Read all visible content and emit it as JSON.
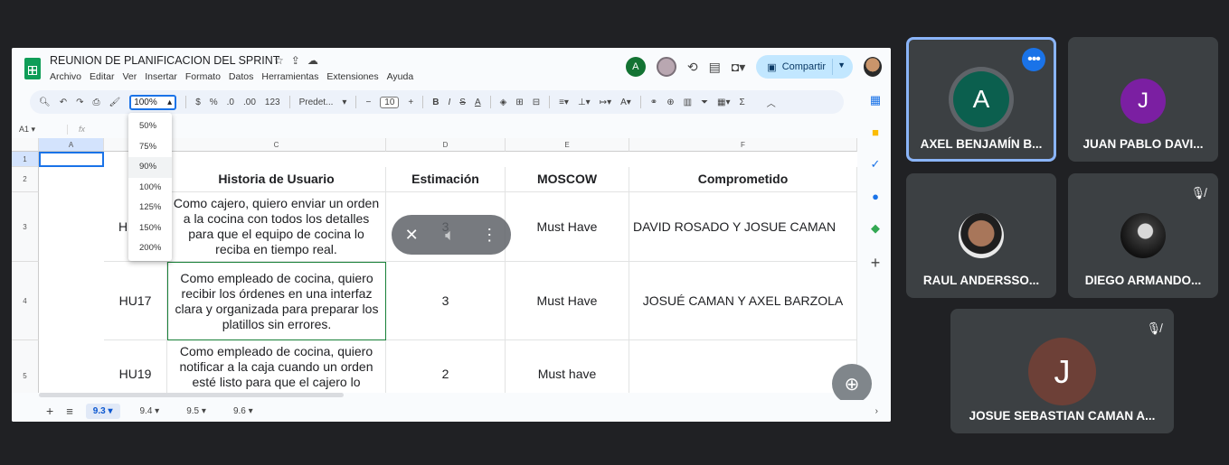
{
  "sheets": {
    "doc_title": "REUNION DE PLANIFICACION DEL SPRINT",
    "menu": [
      "Archivo",
      "Editar",
      "Ver",
      "Insertar",
      "Formato",
      "Datos",
      "Herramientas",
      "Extensiones",
      "Ayuda"
    ],
    "collaborator_initial": "A",
    "share_label": "Compartir",
    "toolbar": {
      "zoom_value": "100%",
      "currency": "$",
      "percent": "%",
      "dec_less": ".0",
      "dec_more": ".00",
      "number_format": "123",
      "font_name": "Predet...",
      "font_size": "10"
    },
    "cell_ref": "A1",
    "fx_label": "fx",
    "zoom_options": [
      "50%",
      "75%",
      "90%",
      "100%",
      "125%",
      "150%",
      "200%"
    ],
    "columns": [
      "A",
      "",
      "C",
      "D",
      "E",
      "F"
    ],
    "row_numbers": [
      "1",
      "2",
      "3",
      "4",
      "5"
    ],
    "headers": {
      "historia": "Historia de Usuario",
      "estimacion": "Estimación",
      "moscow": "MOSCOW",
      "comprometido": "Comprometido"
    },
    "rows": [
      {
        "id": "H",
        "historia": "Como cajero, quiero enviar un orden a la cocina con todos los detalles para que el equipo de cocina lo reciba en tiempo real.",
        "estimacion": "3",
        "moscow": "Must Have",
        "comprometido": "DAVID ROSADO Y JOSUE CAMAN"
      },
      {
        "id": "HU17",
        "historia": "Como empleado de cocina, quiero recibir los órdenes en una interfaz clara y organizada para preparar los platillos sin errores.",
        "estimacion": "3",
        "moscow": "Must Have",
        "comprometido": "JOSUÉ CAMAN Y AXEL BARZOLA"
      },
      {
        "id": "HU19",
        "historia": "Como empleado de cocina, quiero notificar a la caja cuando un orden esté listo para que el cajero lo",
        "estimacion": "2",
        "moscow": "Must have",
        "comprometido": ""
      }
    ],
    "sheet_tabs": [
      "9.3",
      "9.4",
      "9.5",
      "9.6"
    ],
    "active_tab": "9.3"
  },
  "participants": [
    {
      "name": "AXEL BENJAMÍN B...",
      "initial": "A",
      "avatar_color": "#0b5f4e",
      "speaking": true
    },
    {
      "name": "JUAN PABLO DAVI...",
      "initial": "J",
      "avatar_color": "#7b1fa2",
      "muted": false
    },
    {
      "name": "RAUL ANDERSSO...",
      "initial": "",
      "photo": true,
      "muted": false
    },
    {
      "name": "DIEGO ARMANDO...",
      "initial": "",
      "photo": true,
      "muted": true
    },
    {
      "name": "JOSUE SEBASTIAN CAMAN A...",
      "initial": "J",
      "avatar_color": "#6d4037",
      "muted": true
    }
  ],
  "colors": {
    "background": "#202124",
    "tile": "#3c4043",
    "speaking_outline": "#8ab4f8",
    "accent": "#1a73e8"
  },
  "icons": [
    "search-icon",
    "undo-icon",
    "redo-icon",
    "print-icon",
    "paint-format-icon",
    "star-icon",
    "history-icon",
    "comment-icon",
    "video-icon",
    "lock-icon",
    "mic-off-icon",
    "more-vert-icon",
    "zoom-in-icon"
  ]
}
